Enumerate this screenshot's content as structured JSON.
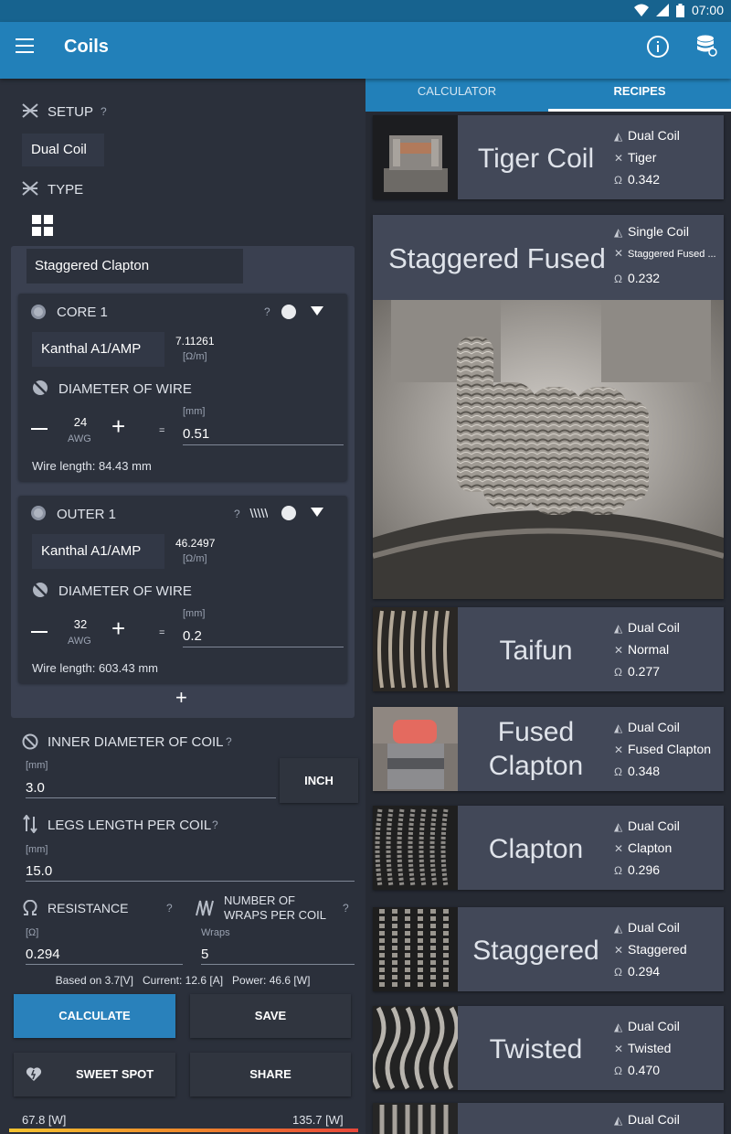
{
  "status": {
    "time": "07:00"
  },
  "app": {
    "title": "Coils"
  },
  "setup": {
    "label": "SETUP",
    "help": "?",
    "value": "Dual Coil",
    "type_label": "TYPE",
    "type_value": "Staggered Clapton"
  },
  "core": {
    "title": "CORE 1",
    "help": "?",
    "material": "Kanthal A1/AMP",
    "ohm_value": "7.11261",
    "ohm_unit": "[Ω/m]",
    "diameter_label": "DIAMETER OF WIRE",
    "awg": "24",
    "awg_label": "AWG",
    "mm_label": "[mm]",
    "eq": "=",
    "mm_value": "0.51",
    "wire_length": "Wire length: 84.43 mm"
  },
  "outer": {
    "title": "OUTER 1",
    "help": "?",
    "material": "Kanthal A1/AMP",
    "ohm_value": "46.2497",
    "ohm_unit": "[Ω/m]",
    "diameter_label": "DIAMETER OF WIRE",
    "awg": "32",
    "awg_label": "AWG",
    "mm_label": "[mm]",
    "eq": "=",
    "mm_value": "0.2",
    "wire_length": "Wire length: 603.43 mm"
  },
  "add_label": "+",
  "inner": {
    "label": "INNER DIAMETER OF COIL",
    "help": "?",
    "unit": "[mm]",
    "value": "3.0",
    "inch_button": "INCH"
  },
  "legs": {
    "label": "LEGS LENGTH PER COIL",
    "help": "?",
    "unit": "[mm]",
    "value": "15.0"
  },
  "resistance": {
    "label": "RESISTANCE",
    "help": "?",
    "unit": "[Ω]",
    "value": "0.294"
  },
  "wraps": {
    "label_line1": "NUMBER OF",
    "label_line2": "WRAPS PER COIL",
    "help": "?",
    "unit": "Wraps",
    "value": "5"
  },
  "based_on": "Based on 3.7[V]   Current: 12.6 [A]   Power: 46.6 [W]",
  "buttons": {
    "calculate": "CALCULATE",
    "save": "SAVE",
    "sweet_spot": "SWEET SPOT",
    "share": "SHARE"
  },
  "power_range": {
    "min": "67.8 [W]",
    "max": "135.7 [W]"
  },
  "tabs": {
    "calculator": "CALCULATOR",
    "recipes": "RECIPES",
    "active": "recipes"
  },
  "recipes": [
    {
      "name": "Tiger Coil",
      "setup": "Dual Coil",
      "type": "Tiger",
      "resistance": "0.342"
    },
    {
      "name": "Staggered Fused",
      "setup": "Single Coil",
      "type": "Staggered Fused ...",
      "resistance": "0.232"
    },
    {
      "name": "Taifun",
      "setup": "Dual Coil",
      "type": "Normal",
      "resistance": "0.277"
    },
    {
      "name_line1": "Fused",
      "name_line2": "Clapton",
      "setup": "Dual Coil",
      "type": "Fused Clapton",
      "resistance": "0.348"
    },
    {
      "name": "Clapton",
      "setup": "Dual Coil",
      "type": "Clapton",
      "resistance": "0.296"
    },
    {
      "name": "Staggered",
      "setup": "Dual Coil",
      "type": "Staggered",
      "resistance": "0.294"
    },
    {
      "name": "Twisted",
      "setup": "Dual Coil",
      "type": "Twisted",
      "resistance": "0.470"
    },
    {
      "setup": "Dual Coil"
    }
  ],
  "ohm_symbol": "Ω"
}
